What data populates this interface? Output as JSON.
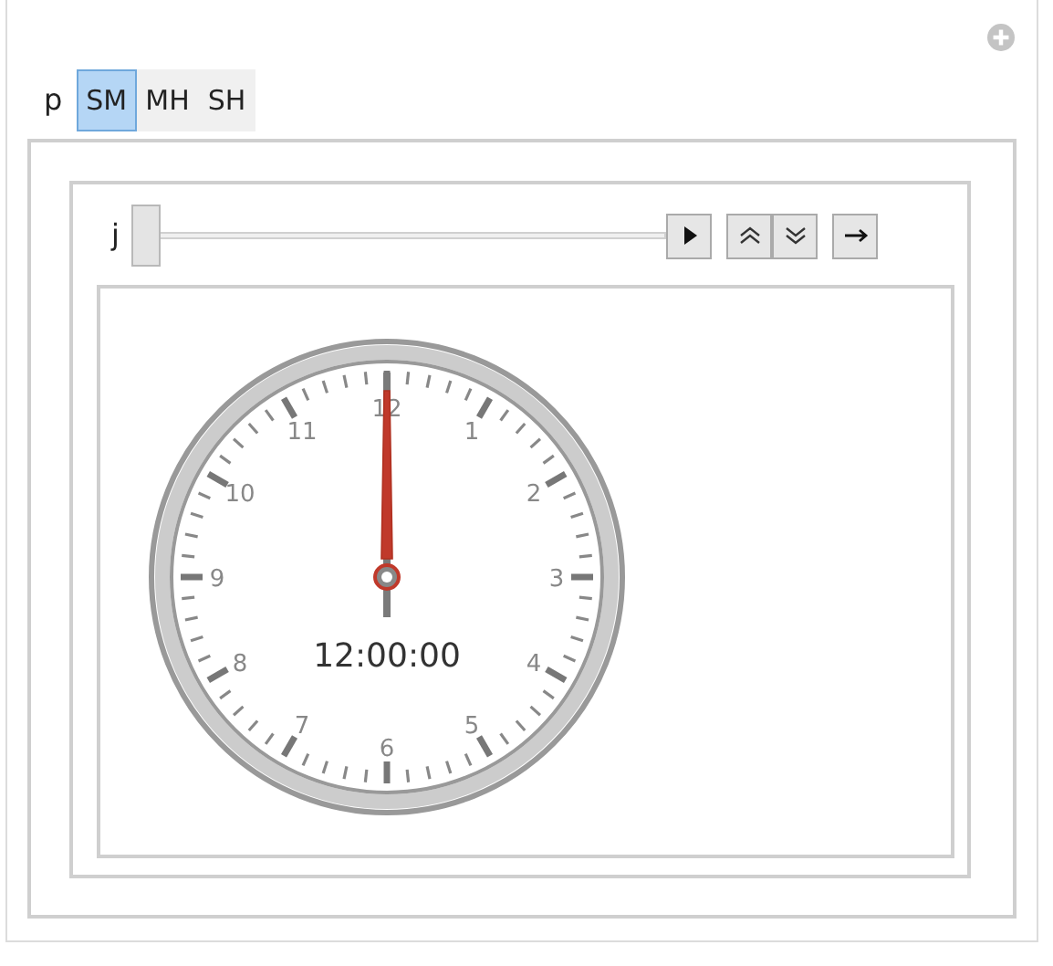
{
  "controls": {
    "p": {
      "label": "p",
      "options": [
        {
          "label": "SM",
          "selected": true
        },
        {
          "label": "MH",
          "selected": false
        },
        {
          "label": "SH",
          "selected": false
        }
      ]
    },
    "j": {
      "label": "j",
      "level": 0
    }
  },
  "clock": {
    "numerals": [
      "12",
      "1",
      "2",
      "3",
      "4",
      "5",
      "6",
      "7",
      "8",
      "9",
      "10",
      "11"
    ],
    "time": "12:00:00"
  }
}
